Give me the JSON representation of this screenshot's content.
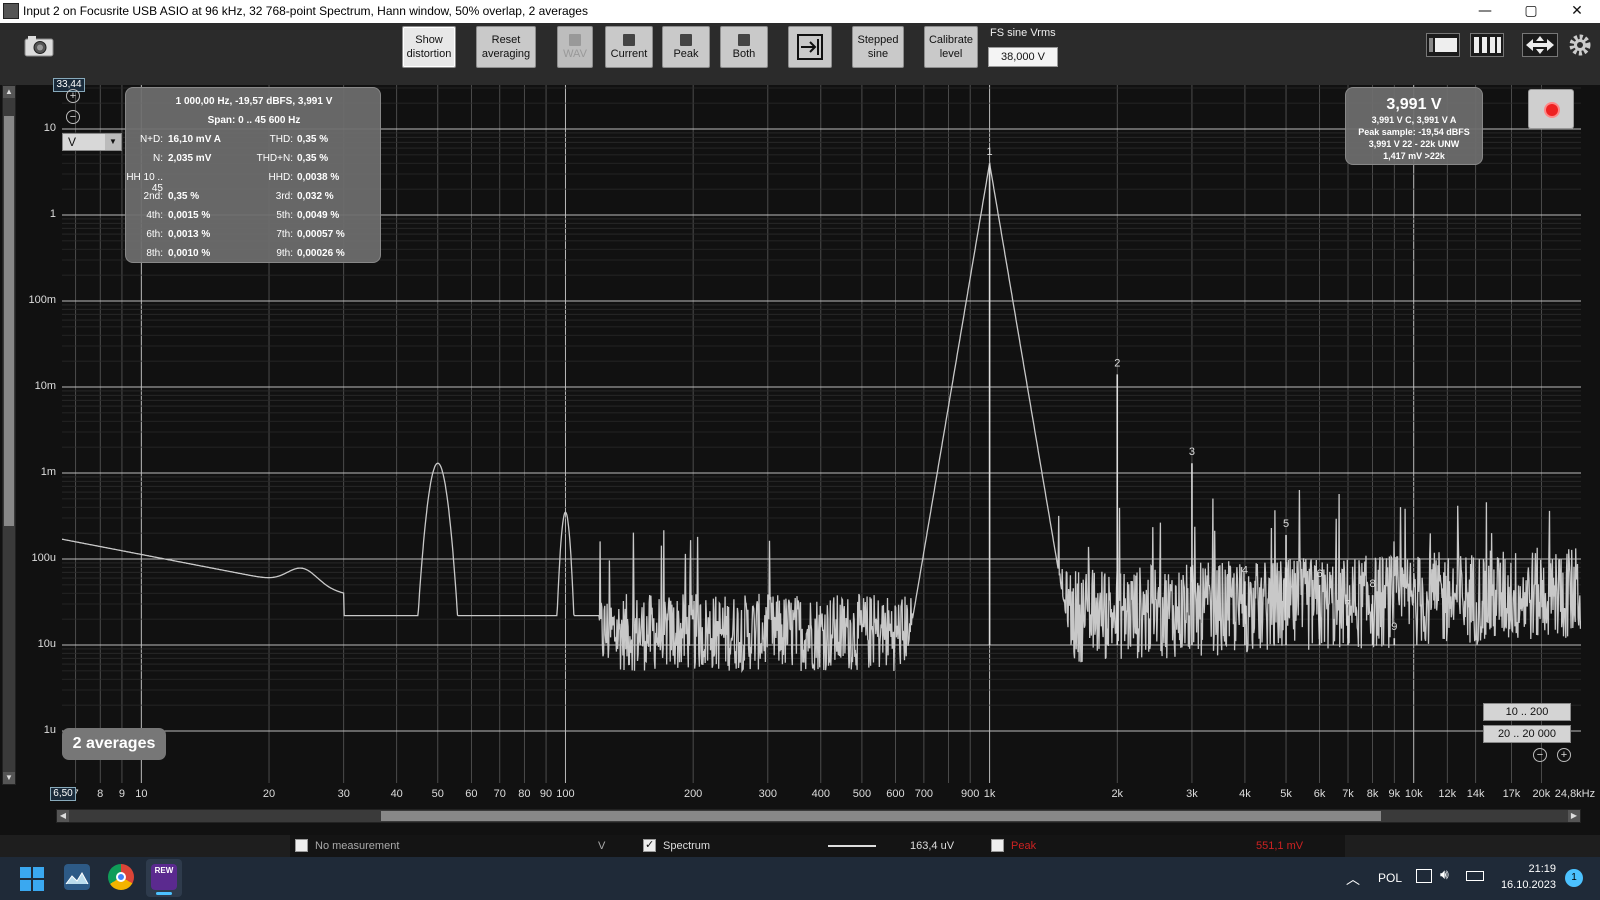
{
  "window": {
    "title": "Input 2 on Focusrite USB ASIO at 96 kHz, 32 768-point Spectrum, Hann window, 50% overlap, 2 averages",
    "minimize": "—",
    "maximize": "▢",
    "close": "✕"
  },
  "toolbar": {
    "show_distortion": [
      "Show",
      "distortion"
    ],
    "reset_averaging": [
      "Reset",
      "averaging"
    ],
    "wav": "WAV",
    "current": "Current",
    "peak": "Peak",
    "both": "Both",
    "stepped_sine": [
      "Stepped",
      "sine"
    ],
    "calibrate_level": [
      "Calibrate",
      "level"
    ],
    "fs_label": "FS sine Vrms",
    "fs_value": "38,000 V"
  },
  "graph": {
    "y_top_value": "33,44",
    "x_left_value": "6,50",
    "unit": "V",
    "y_labels": [
      "10",
      "1",
      "100m",
      "10m",
      "1m",
      "100u",
      "10u",
      "1u"
    ],
    "x_labels": [
      "7",
      "8",
      "9",
      "10",
      "20",
      "30",
      "40",
      "50",
      "60",
      "70",
      "80",
      "90",
      "100",
      "200",
      "300",
      "400",
      "500",
      "600",
      "700",
      "900",
      "1k",
      "2k",
      "3k",
      "4k",
      "5k",
      "6k",
      "7k",
      "8k",
      "9k",
      "10k",
      "12k",
      "14k",
      "17k",
      "20k",
      "24,8kHz"
    ],
    "harmonic_labels": [
      "1",
      "2",
      "3",
      "4",
      "5",
      "6",
      "7",
      "8",
      "9"
    ],
    "averages_badge": "2 averages",
    "range_btn_1": "10 .. 200",
    "range_btn_2": "20 .. 20 000"
  },
  "distortion": {
    "header": "1 000,00 Hz, -19,57 dBFS, 3,991 V",
    "span": "Span: 0 .. 45 600 Hz",
    "rows": [
      {
        "l1": "N+D:",
        "v1": "16,10 mV A",
        "l2": "THD:",
        "v2": "0,35 %"
      },
      {
        "l1": "N:",
        "v1": "2,035 mV",
        "l2": "THD+N:",
        "v2": "0,35 %"
      },
      {
        "l1": "HH 10 .. 45",
        "v1": "",
        "l2": "HHD:",
        "v2": "0,0038 %"
      },
      {
        "l1": "2nd:",
        "v1": "0,35 %",
        "l2": "3rd:",
        "v2": "0,032 %"
      },
      {
        "l1": "4th:",
        "v1": "0,0015 %",
        "l2": "5th:",
        "v2": "0,0049 %"
      },
      {
        "l1": "6th:",
        "v1": "0,0013 %",
        "l2": "7th:",
        "v2": "0,00057 %"
      },
      {
        "l1": "8th:",
        "v1": "0,0010 %",
        "l2": "9th:",
        "v2": "0,00026 %"
      }
    ]
  },
  "level": {
    "main": "3,991 V",
    "l1": "3,991 V C, 3,991 V A",
    "l2": "Peak sample: -19,54 dBFS",
    "l3": "3,991 V 22 - 22k UNW",
    "l4": "1,417 mV >22k"
  },
  "legend": {
    "no_measurement": "No measurement",
    "unit": "V",
    "spectrum": "Spectrum",
    "spectrum_value": "163,4 uV",
    "peak": "Peak",
    "peak_value": "551,1 mV"
  },
  "taskbar": {
    "lang": "POL",
    "time": "21:19",
    "date": "16.10.2023",
    "notif": "1"
  },
  "colors": {
    "trace": "#c8c8c8",
    "grid": "#5a5a5a",
    "peak": "#cc2222"
  }
}
